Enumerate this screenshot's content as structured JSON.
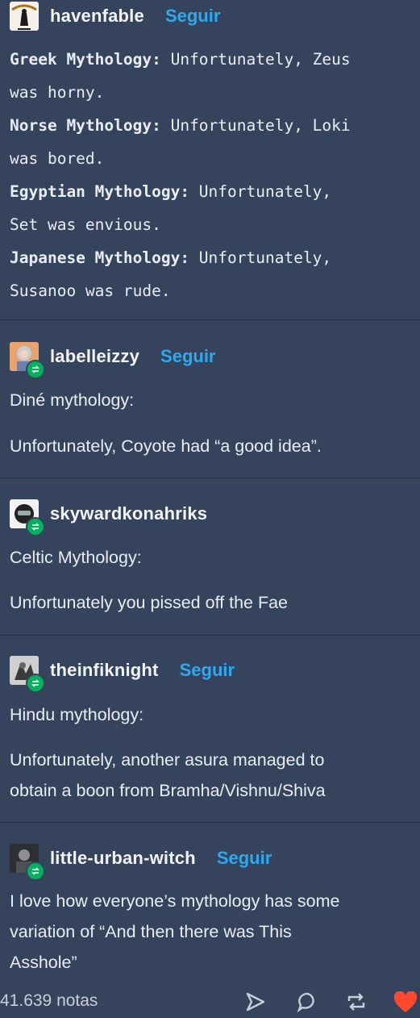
{
  "posts": [
    {
      "username": "havenfable",
      "follow_label": "Seguir",
      "lines": [
        {
          "label": "Greek Mythology:",
          "text": " Unfortunately, Zeus",
          "cont": "was horny."
        },
        {
          "label": "Norse Mythology:",
          "text": " Unfortunately, Loki",
          "cont": "was bored."
        },
        {
          "label": "Egyptian Mythology:",
          "text": " Unfortunately,",
          "cont": "Set was envious."
        },
        {
          "label": "Japanese Mythology:",
          "text": " Unfortunately,",
          "cont": "Susanoo was rude."
        }
      ]
    },
    {
      "username": "labelleizzy",
      "follow_label": "Seguir",
      "paragraphs": [
        "Diné mythology:",
        "Unfortunately, Coyote had “a good idea”."
      ]
    },
    {
      "username": "skywardkonahriks",
      "paragraphs": [
        "Celtic Mythology:",
        "Unfortunately you pissed off the Fae"
      ]
    },
    {
      "username": "theinfiknight",
      "follow_label": "Seguir",
      "paragraphs": [
        "Hindu mythology:",
        "Unfortunately, another asura managed to",
        "obtain a boon from Bramha/Vishnu/Shiva"
      ]
    },
    {
      "username": "little-urban-witch",
      "follow_label": "Seguir",
      "paragraphs": [
        "I love how everyone’s mythology has some",
        "variation of “And then there was This",
        "Asshole”"
      ]
    }
  ],
  "footer": {
    "notes": "41.639 notas",
    "icons": [
      "share-icon",
      "comment-icon",
      "reblog-icon",
      "like-icon"
    ],
    "like_color": "#ff492f"
  },
  "colors": {
    "background": "#35445c",
    "follow": "#2da9f0",
    "reblog_badge": "#00b15e"
  }
}
